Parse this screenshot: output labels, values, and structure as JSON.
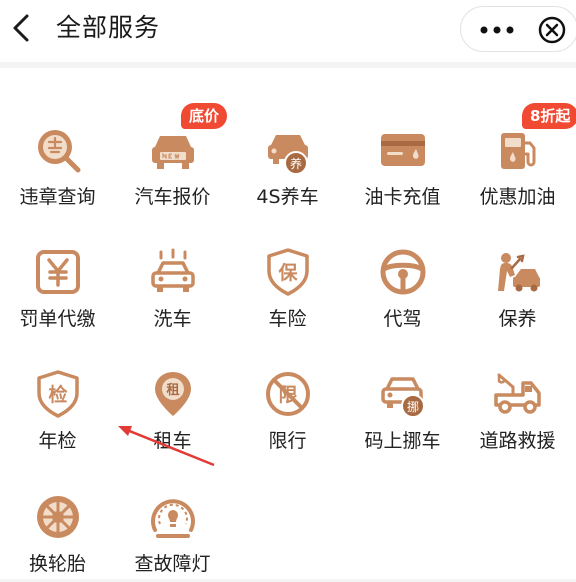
{
  "header": {
    "title": "全部服务"
  },
  "colors": {
    "accent": "#c98a5f",
    "badge": "#f04a33",
    "arrow": "#e23a35"
  },
  "services": [
    {
      "label": "违章查询",
      "icon": "violation-search-icon"
    },
    {
      "label": "汽车报价",
      "icon": "new-car-icon",
      "badge": "底价"
    },
    {
      "label": "4S养车",
      "icon": "car-maintenance-icon"
    },
    {
      "label": "油卡充值",
      "icon": "fuel-card-icon"
    },
    {
      "label": "优惠加油",
      "icon": "fuel-pump-icon",
      "badge": "8折起"
    },
    {
      "label": "罚单代缴",
      "icon": "fine-ticket-icon"
    },
    {
      "label": "洗车",
      "icon": "car-wash-icon"
    },
    {
      "label": "车险",
      "icon": "insurance-shield-icon"
    },
    {
      "label": "代驾",
      "icon": "steering-wheel-icon"
    },
    {
      "label": "保养",
      "icon": "mechanic-icon"
    },
    {
      "label": "年检",
      "icon": "inspection-shield-icon"
    },
    {
      "label": "租车",
      "icon": "rental-pin-icon"
    },
    {
      "label": "限行",
      "icon": "restriction-icon"
    },
    {
      "label": "码上挪车",
      "icon": "move-car-icon"
    },
    {
      "label": "道路救援",
      "icon": "tow-truck-icon"
    },
    {
      "label": "换轮胎",
      "icon": "tire-icon"
    },
    {
      "label": "查故障灯",
      "icon": "warning-light-icon"
    }
  ]
}
